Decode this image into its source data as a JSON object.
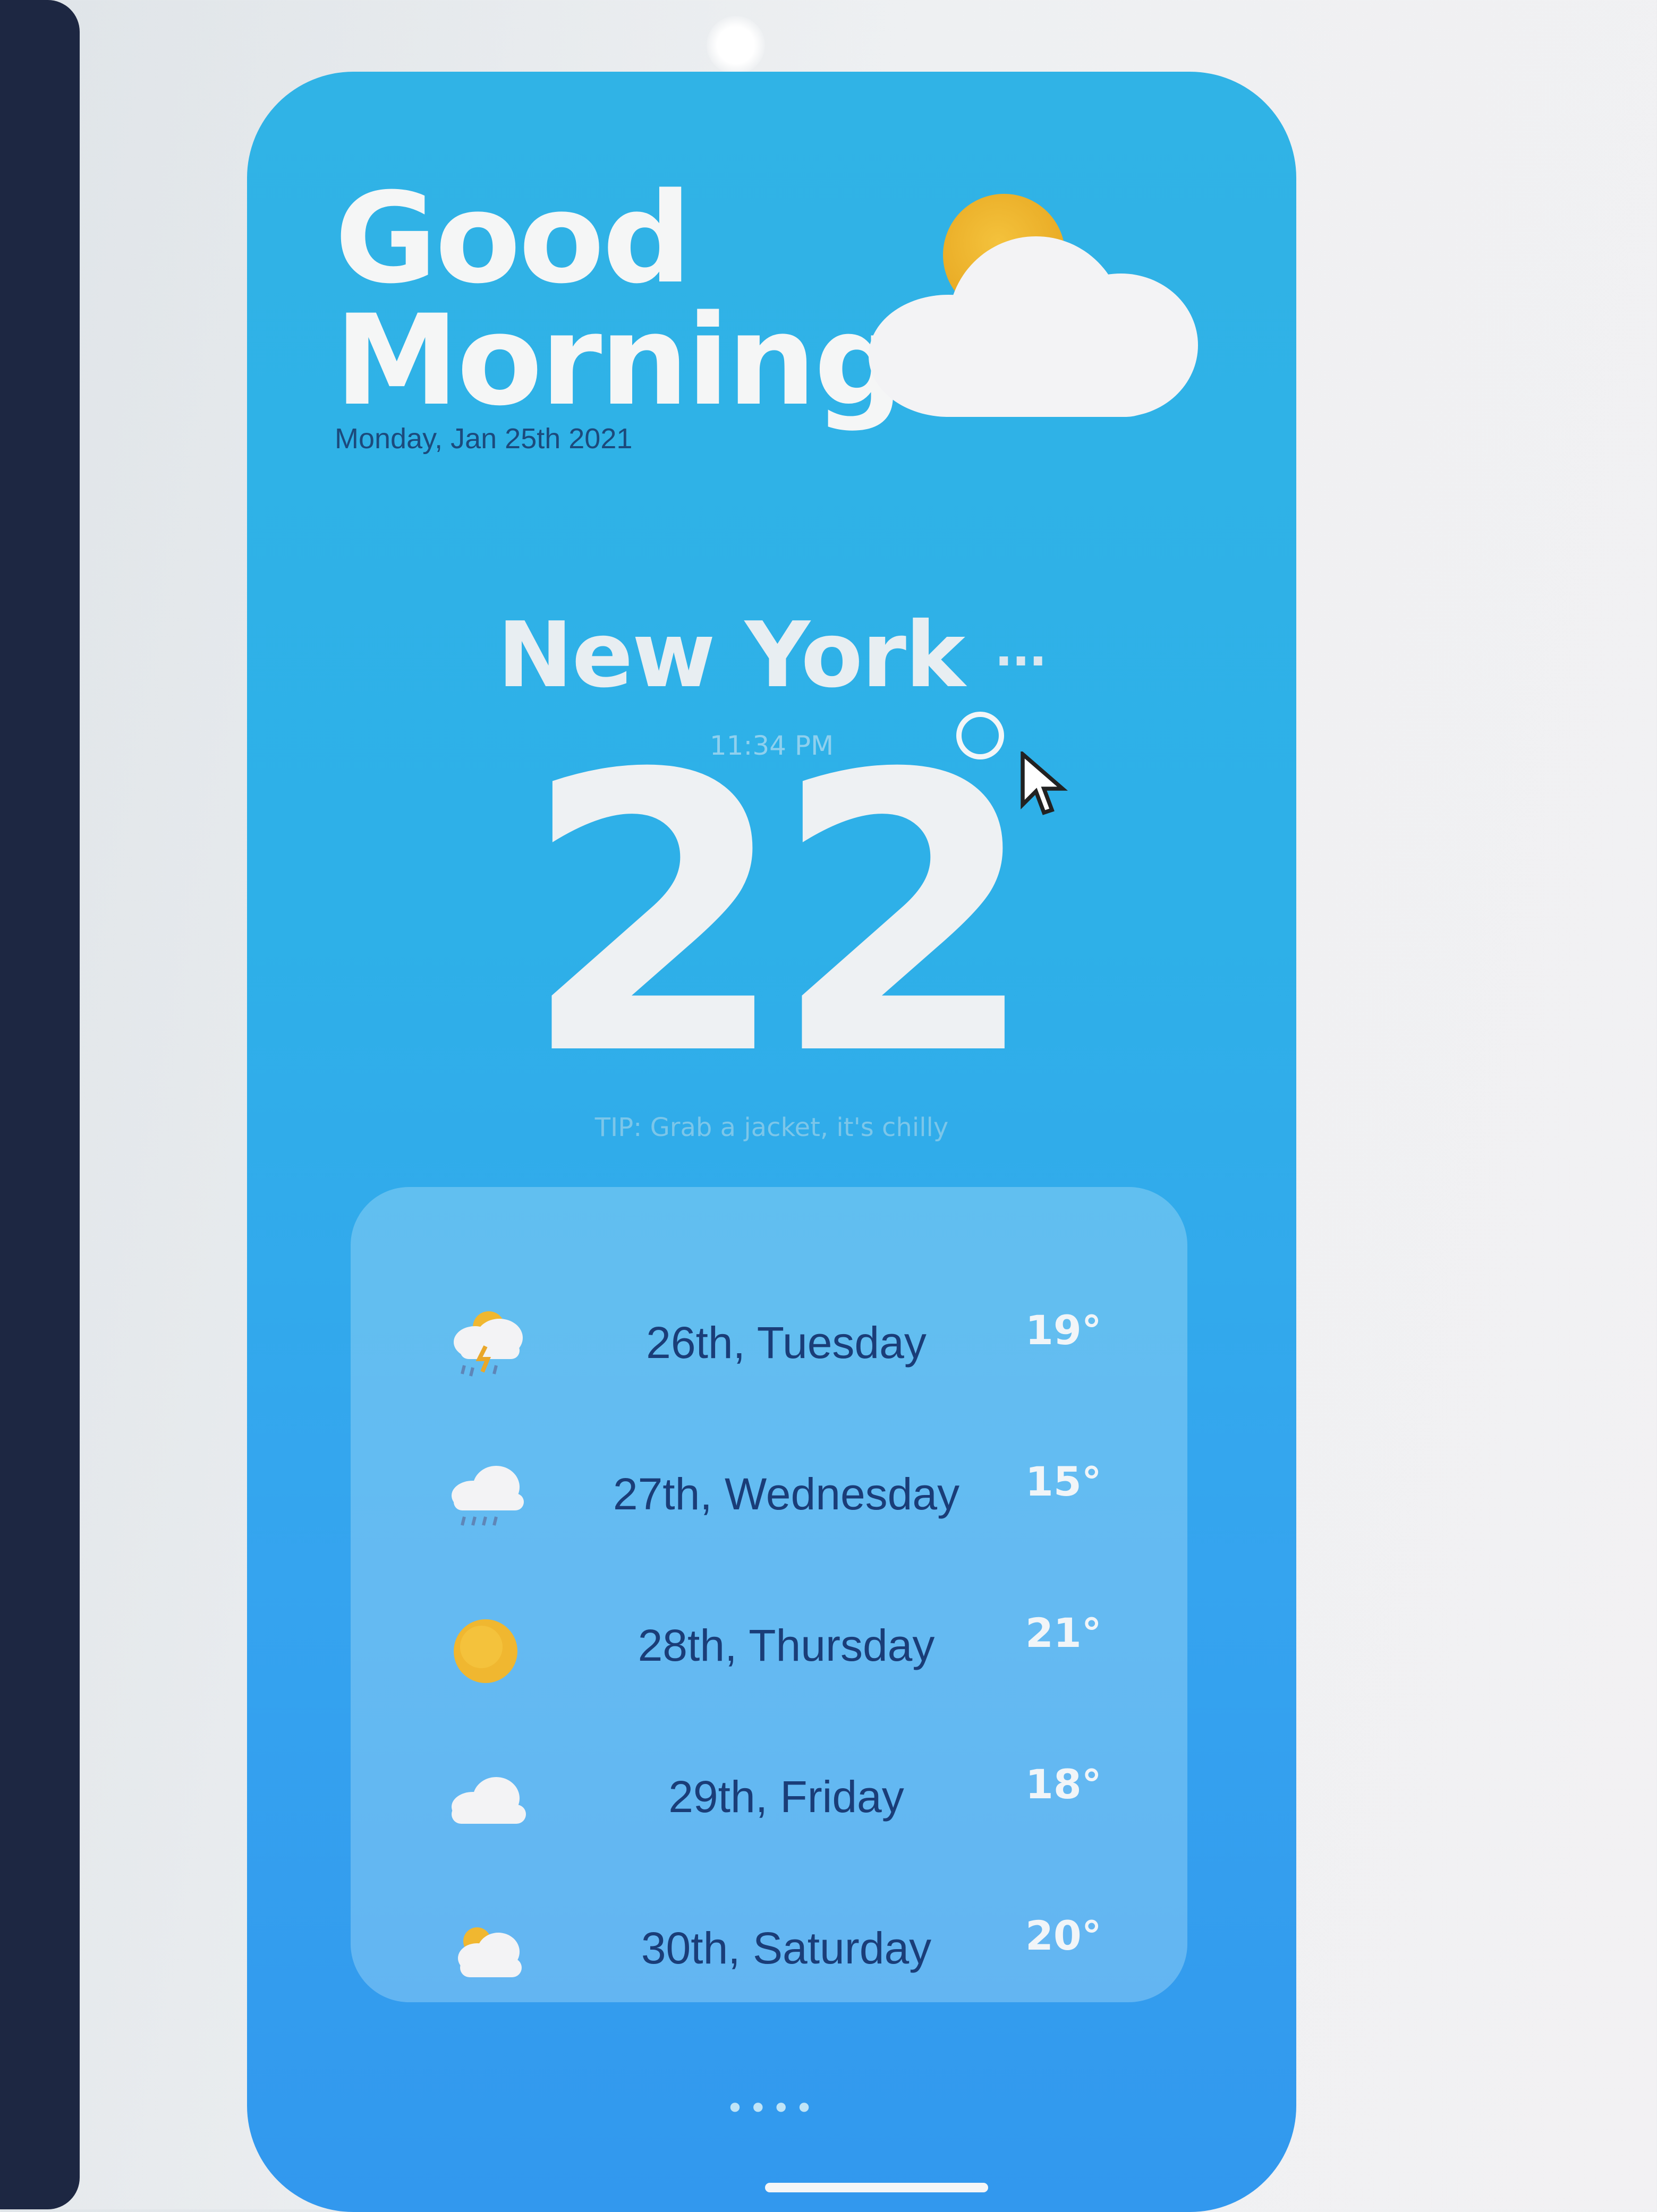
{
  "greeting": {
    "line1": "Good",
    "line2": "Morning"
  },
  "date": "Monday, Jan 25th 2021",
  "location": {
    "city": "New York",
    "menu_dots": "···",
    "time": "11:34 PM"
  },
  "current": {
    "temperature": "22"
  },
  "tip": "TIP: Grab a jacket, it's chilly",
  "forecast": [
    {
      "day": "26th, Tuesday",
      "temp": "19°",
      "icon": "rain-sun-cloud-icon"
    },
    {
      "day": "27th, Wednesday",
      "temp": "15°",
      "icon": "rain-cloud-icon"
    },
    {
      "day": "28th, Thursday",
      "temp": "21°",
      "icon": "sun-icon"
    },
    {
      "day": "29th, Friday",
      "temp": "18°",
      "icon": "cloud-icon"
    },
    {
      "day": "30th, Saturday",
      "temp": "20°",
      "icon": "partly-cloudy-icon"
    }
  ],
  "page_dots": "••••",
  "colors": {
    "card": "#30b3e6",
    "day_text": "#1a3d78",
    "sun": "#f0b730",
    "cloud": "#f3f3f5"
  }
}
